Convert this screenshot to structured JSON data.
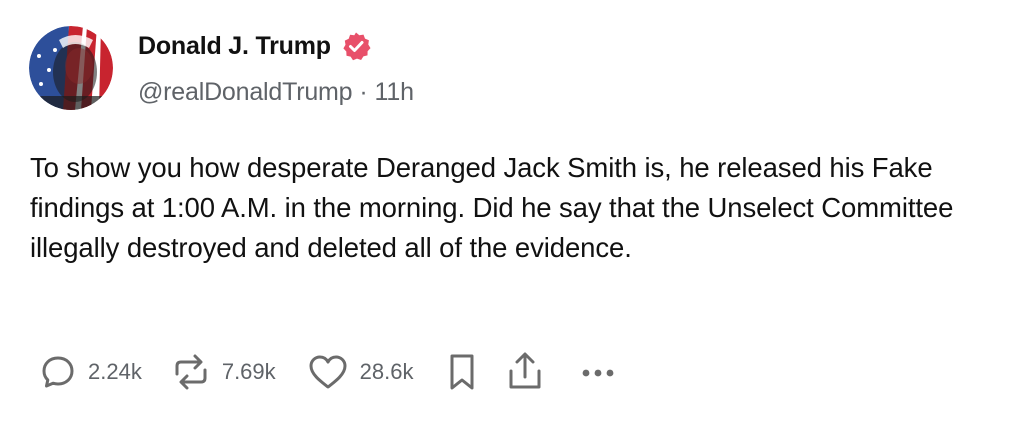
{
  "author": {
    "display_name": "Donald J. Trump",
    "handle": "@realDonaldTrump",
    "separator": "·",
    "timestamp": "11h",
    "verified": true
  },
  "post": {
    "text": "To show you how desperate Deranged Jack Smith is, he released his Fake findings at 1:00 A.M. in the morning. Did he say that the Unselect Committee illegally destroyed and deleted all of the evidence."
  },
  "actions": {
    "reply_count": "2.24k",
    "repost_count": "7.69k",
    "like_count": "28.6k"
  },
  "colors": {
    "verified_badge": "#e8506a",
    "text": "#111111",
    "secondary_text": "#5f6368",
    "icon": "#6b6b6b"
  },
  "icons": [
    "reply-icon",
    "repost-icon",
    "like-icon",
    "bookmark-icon",
    "share-icon",
    "more-icon",
    "verified-badge-icon"
  ]
}
